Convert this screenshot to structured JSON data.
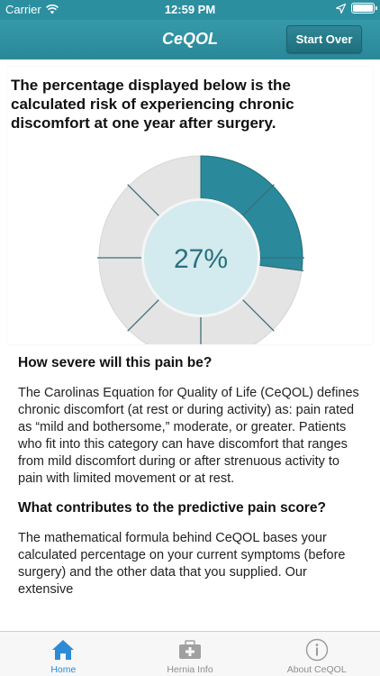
{
  "status_bar": {
    "carrier": "Carrier",
    "time": "12:59 PM"
  },
  "nav": {
    "title": "CeQOL",
    "start_over_label": "Start Over"
  },
  "headline": "The percentage displayed below is the calculated risk of experiencing chronic discomfort at one year after surgery.",
  "gauge": {
    "label": "27%",
    "value": 0.27,
    "fill_color": "#2a8a9c",
    "track_color": "#e4e4e4",
    "center_color": "#d3eaee"
  },
  "sections": [
    {
      "title": "How severe will this pain be?",
      "text": "The Carolinas Equation for Quality of Life (CeQOL) defines chronic discomfort (at rest or during activity) as: pain rated as “mild and bothersome,” moderate, or greater. Patients who fit into this category can have discomfort that ranges from mild discomfort during or after strenuous activity to pain with limited movement or at rest."
    },
    {
      "title": "What contributes to the predictive pain score?",
      "text": "The mathematical formula behind CeQOL bases your calculated percentage on your current symptoms (before surgery) and the other data that you supplied. Our extensive"
    }
  ],
  "tabs": [
    {
      "label": "Home",
      "icon": "home-icon",
      "active": true
    },
    {
      "label": "Hernia Info",
      "icon": "medical-kit-icon",
      "active": false
    },
    {
      "label": "About CeQOL",
      "icon": "info-icon",
      "active": false
    }
  ],
  "colors": {
    "accent": "#2b8fa0",
    "tab_active": "#2d8bd6"
  }
}
